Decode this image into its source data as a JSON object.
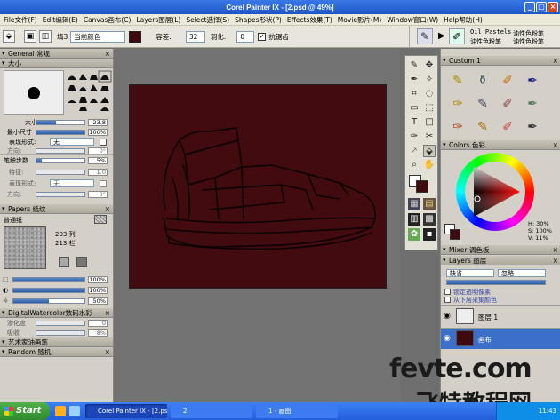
{
  "window": {
    "title": "Corel Painter IX - [2.psd @ 49%]"
  },
  "menu": [
    "File文件(F)",
    "Edit编辑(E)",
    "Canvas画布(C)",
    "Layers图层(L)",
    "Select选择(S)",
    "Shapes形状(P)",
    "Effects效果(T)",
    "Movie影片(M)",
    "Window窗口(W)",
    "Help帮助(H)"
  ],
  "property_bar": {
    "fill_label": "填3",
    "fill_source": "当前颜色",
    "tolerance_label": "容差:",
    "tolerance_value": "32",
    "feather_label": "羽化:",
    "feather_value": "0",
    "antialias_label": "抗锯齿",
    "current_color": "#3d0a10"
  },
  "brush_selector": {
    "category": "Oil Pastels",
    "variant": "油性色粉笔",
    "category_cn": "油性色粉笔",
    "variant_cn": "油性色粉笔"
  },
  "general": {
    "header": "General 常规",
    "size_header": "大小",
    "size_label": "大小:",
    "size_value": "23.8",
    "min_size_label": "最小尺寸",
    "min_size_value": "100%",
    "expression_label": "表现形式:",
    "expression_value": "无",
    "direction_label": "方向:",
    "direction_value": "0°",
    "spacing_label": "笔触步数",
    "spacing_value": "5%",
    "feature_label": "特征:",
    "feature_value": "1.0",
    "expression2_label": "表现形式:",
    "expression2_value": "无",
    "direction2_label": "方向:",
    "direction2_value": "0°"
  },
  "papers": {
    "header": "Papers 纸纹",
    "paper_name": "普通纸",
    "rows": "203 列",
    "cols": "213 栏",
    "scale_value": "100%",
    "contrast_value": "100%",
    "brightness_value": "50%"
  },
  "watercolor": {
    "header": "DigitalWatercolor数码水彩",
    "wet_label": "渗化度",
    "wet_value": "0",
    "dry_label": "吸收",
    "dry_value": "8%"
  },
  "collapsed_sections": [
    "艺术家油画笔",
    "Random 随机"
  ],
  "custom": {
    "header": "Custom 1"
  },
  "colors": {
    "header": "Colors 色彩",
    "h": "H: 30%",
    "s": "S: 100%",
    "v": "V: 11%"
  },
  "mixer": {
    "header": "Mixer 调色板"
  },
  "layers": {
    "header": "Layers 图层",
    "blend_mode": "缺省",
    "composite": "忽略",
    "preserve_transparency": "锁定透明像素",
    "pick_up_color": "从下层采集颜色",
    "items": [
      {
        "name": "图层 1"
      },
      {
        "name": "画布"
      }
    ]
  },
  "taskbar": {
    "start": "Start",
    "tasks": [
      "Corel Painter IX - [2.psd]",
      "2",
      "1 - 画图"
    ],
    "clock": "11:43"
  },
  "watermark": {
    "line1": "fevte.com",
    "line2": "飞特教程网"
  }
}
